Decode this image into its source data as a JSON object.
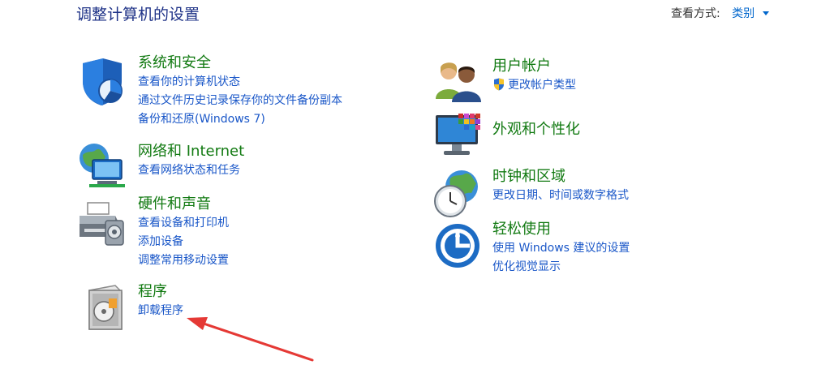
{
  "header": {
    "title": "调整计算机的设置",
    "view_by_label": "查看方式:",
    "view_by_value": "类别"
  },
  "categories": {
    "system_security": {
      "title": "系统和安全",
      "icon": "shield-icon",
      "links": [
        "查看你的计算机状态",
        "通过文件历史记录保存你的文件备份副本",
        "备份和还原(Windows 7)"
      ]
    },
    "network": {
      "title": "网络和 Internet",
      "icon": "network-icon",
      "links": [
        "查看网络状态和任务"
      ]
    },
    "hardware": {
      "title": "硬件和声音",
      "icon": "printer-icon",
      "links": [
        "查看设备和打印机",
        "添加设备",
        "调整常用移动设置"
      ]
    },
    "programs": {
      "title": "程序",
      "icon": "programs-icon",
      "links": [
        "卸载程序"
      ]
    },
    "user_accounts": {
      "title": "用户帐户",
      "icon": "users-icon",
      "links": [
        "更改帐户类型"
      ]
    },
    "appearance": {
      "title": "外观和个性化",
      "icon": "monitor-icon",
      "links": []
    },
    "clock_region": {
      "title": "时钟和区域",
      "icon": "clock-globe-icon",
      "links": [
        "更改日期、时间或数字格式"
      ]
    },
    "ease_of_access": {
      "title": "轻松使用",
      "icon": "ease-of-access-icon",
      "links": [
        "使用 Windows 建议的设置",
        "优化视觉显示"
      ]
    }
  },
  "colors": {
    "category_title": "#127a12",
    "link": "#1a57c8",
    "page_title": "#1e3287",
    "annotation_arrow": "#e53935"
  }
}
